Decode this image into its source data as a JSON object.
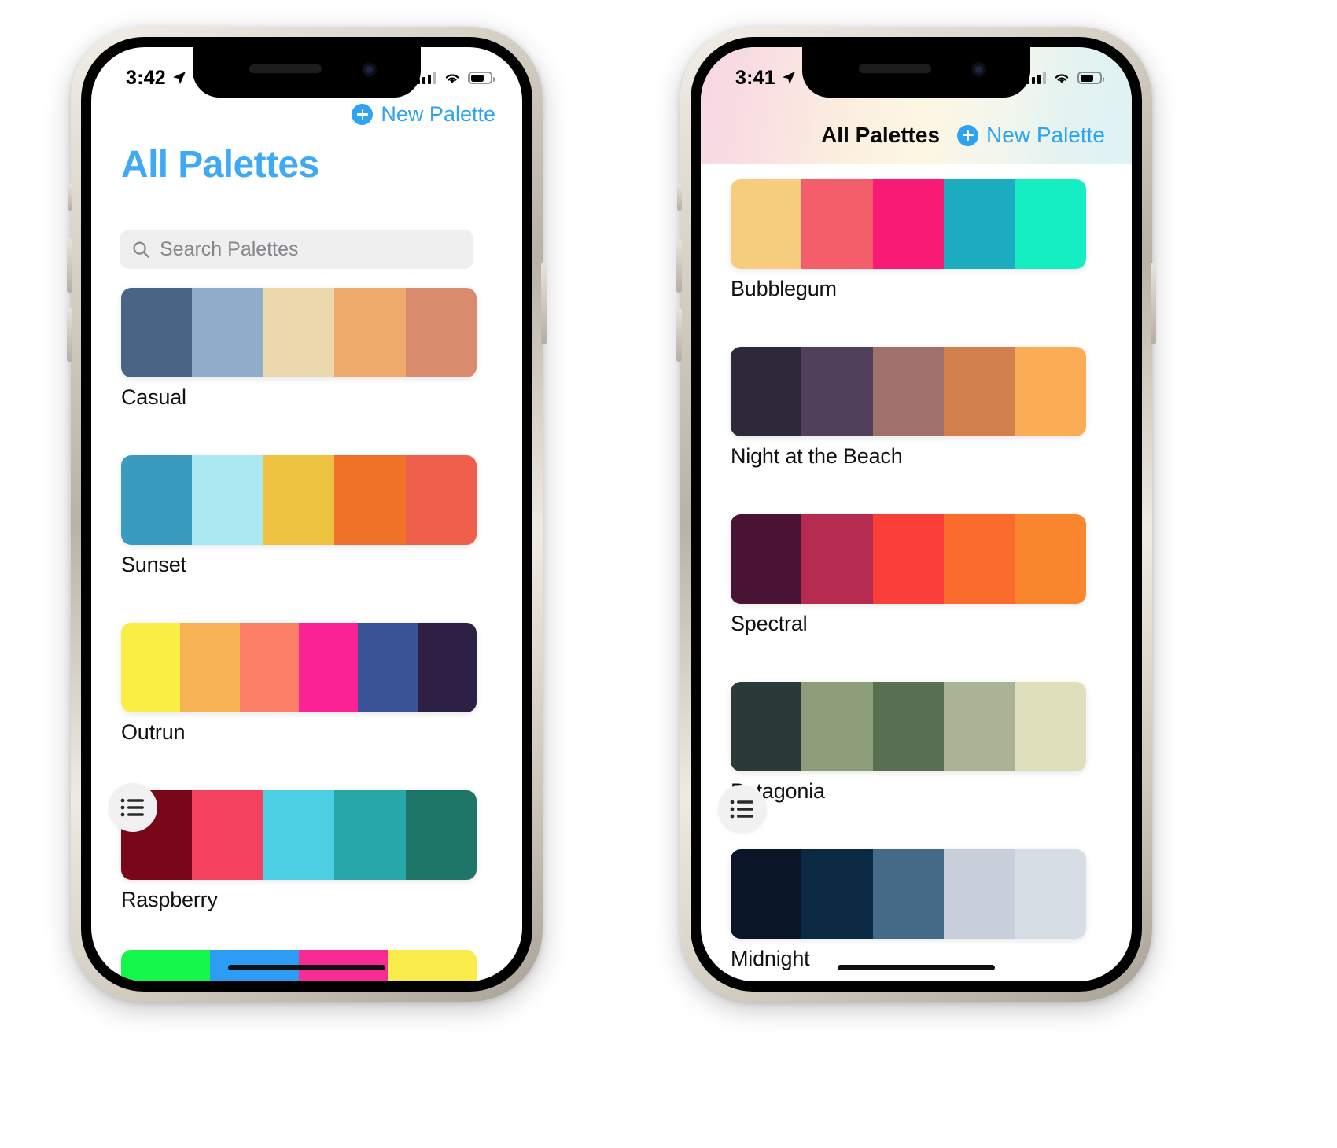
{
  "app": {
    "accent": "#2ea3f2",
    "new_palette_label": "New Palette",
    "plus_icon": "plus-circle-icon",
    "list_icon": "list-bullet-icon"
  },
  "left_phone": {
    "status": {
      "time": "3:42",
      "location_icon": "location-arrow-icon",
      "wifi_icon": "wifi-icon",
      "cellular_icon": "cellular-bars-icon",
      "battery_icon": "battery-icon"
    },
    "nav": {
      "new_palette_label": "New Palette"
    },
    "large_title": "All Palettes",
    "search": {
      "placeholder": "Search Palettes",
      "value": "",
      "icon": "magnifier-icon"
    },
    "palettes": [
      {
        "name": "Casual",
        "colors": [
          "#4a6485",
          "#8fadc9",
          "#ecd9ad",
          "#eeab6c",
          "#d98b6e"
        ]
      },
      {
        "name": "Sunset",
        "colors": [
          "#3a9bc1",
          "#abe9f2",
          "#eec341",
          "#ef7228",
          "#ef5f4b"
        ]
      },
      {
        "name": "Outrun",
        "colors": [
          "#f9ee44",
          "#f7b254",
          "#fc8068",
          "#fb2296",
          "#3a5296",
          "#2e1f44"
        ]
      },
      {
        "name": "Raspberry",
        "colors": [
          "#79061b",
          "#f3415f",
          "#4ccfe2",
          "#27a7a8",
          "#1d7668"
        ]
      }
    ],
    "partial_palette": {
      "colors": [
        "#14f64a",
        "#2d9cf5",
        "#f72b94",
        "#f9ec4a"
      ]
    }
  },
  "right_phone": {
    "status": {
      "time": "3:41",
      "location_icon": "location-arrow-icon",
      "wifi_icon": "wifi-icon",
      "cellular_icon": "cellular-bars-icon",
      "battery_icon": "battery-icon"
    },
    "nav": {
      "title": "All Palettes",
      "new_palette_label": "New Palette"
    },
    "header_gradient": [
      "#f7d7e4",
      "#fbeedf",
      "#fdf7e2",
      "#e2f3f2"
    ],
    "palettes": [
      {
        "name": "Bubblegum",
        "colors": [
          "#f6cd7f",
          "#f35e6b",
          "#f91a73",
          "#1cacbf",
          "#15eec3"
        ]
      },
      {
        "name": "Night at the Beach",
        "colors": [
          "#2f2839",
          "#50405a",
          "#a0706b",
          "#d3804f",
          "#fbad55"
        ]
      },
      {
        "name": "Spectral",
        "colors": [
          "#4a1334",
          "#b62b50",
          "#fb3f38",
          "#fb6b2c",
          "#f9852c"
        ]
      },
      {
        "name": "Patagonia",
        "colors": [
          "#2b3a38",
          "#8d9d7a",
          "#586f52",
          "#aab395",
          "#dfdfbb"
        ]
      },
      {
        "name": "Midnight",
        "colors": [
          "#0a1628",
          "#0d2a44",
          "#456a87",
          "#c6cfda",
          "#d7dde4"
        ]
      }
    ]
  }
}
